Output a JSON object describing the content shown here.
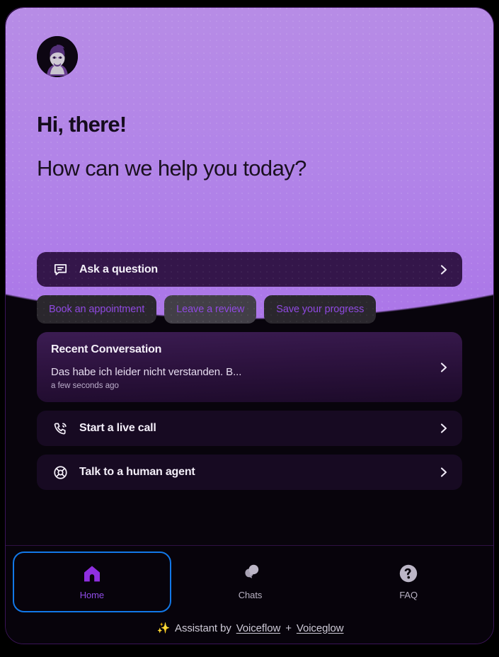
{
  "widget": {
    "accent_purple": "#8f49e0",
    "hero_gradient_top": "#b78ce6",
    "hero_gradient_bottom": "#a971e8",
    "focus_ring_color": "#1278e8",
    "background": "#000000"
  },
  "hero": {
    "avatar_icon": "bearded-person-avatar",
    "greeting_line1": "Hi, there!",
    "greeting_line2": "How can we help you today?"
  },
  "primary_cta": {
    "icon": "chat-bubble-lines-icon",
    "label": "Ask a question",
    "chevron_icon": "chevron-right-icon"
  },
  "quick_replies": [
    {
      "label": "Book an appointment",
      "hovered": false
    },
    {
      "label": "Leave a review",
      "hovered": true
    },
    {
      "label": "Save your progress",
      "hovered": false
    }
  ],
  "recent_conversation": {
    "title": "Recent Conversation",
    "snippet": "Das habe ich leider nicht verstanden. B...",
    "timestamp": "a few seconds ago",
    "chevron_icon": "chevron-right-icon"
  },
  "actions": [
    {
      "icon": "phone-ring-icon",
      "label": "Start a live call",
      "chevron_icon": "chevron-right-icon"
    },
    {
      "icon": "lifebuoy-support-icon",
      "label": "Talk to a human agent",
      "chevron_icon": "chevron-right-icon"
    }
  ],
  "nav": {
    "tabs": [
      {
        "icon": "home-icon",
        "label": "Home",
        "active": true,
        "focused": true
      },
      {
        "icon": "chats-bubbles-icon",
        "label": "Chats",
        "active": false,
        "focused": false
      },
      {
        "icon": "question-mark-circle-icon",
        "label": "FAQ",
        "active": false,
        "focused": false
      }
    ]
  },
  "footer": {
    "sparkle_icon": "sparkles-icon",
    "sparkle_glyph": "✨",
    "prefix": "Assistant by",
    "link1": "Voiceflow",
    "separator": "+",
    "link2": "Voiceglow"
  }
}
